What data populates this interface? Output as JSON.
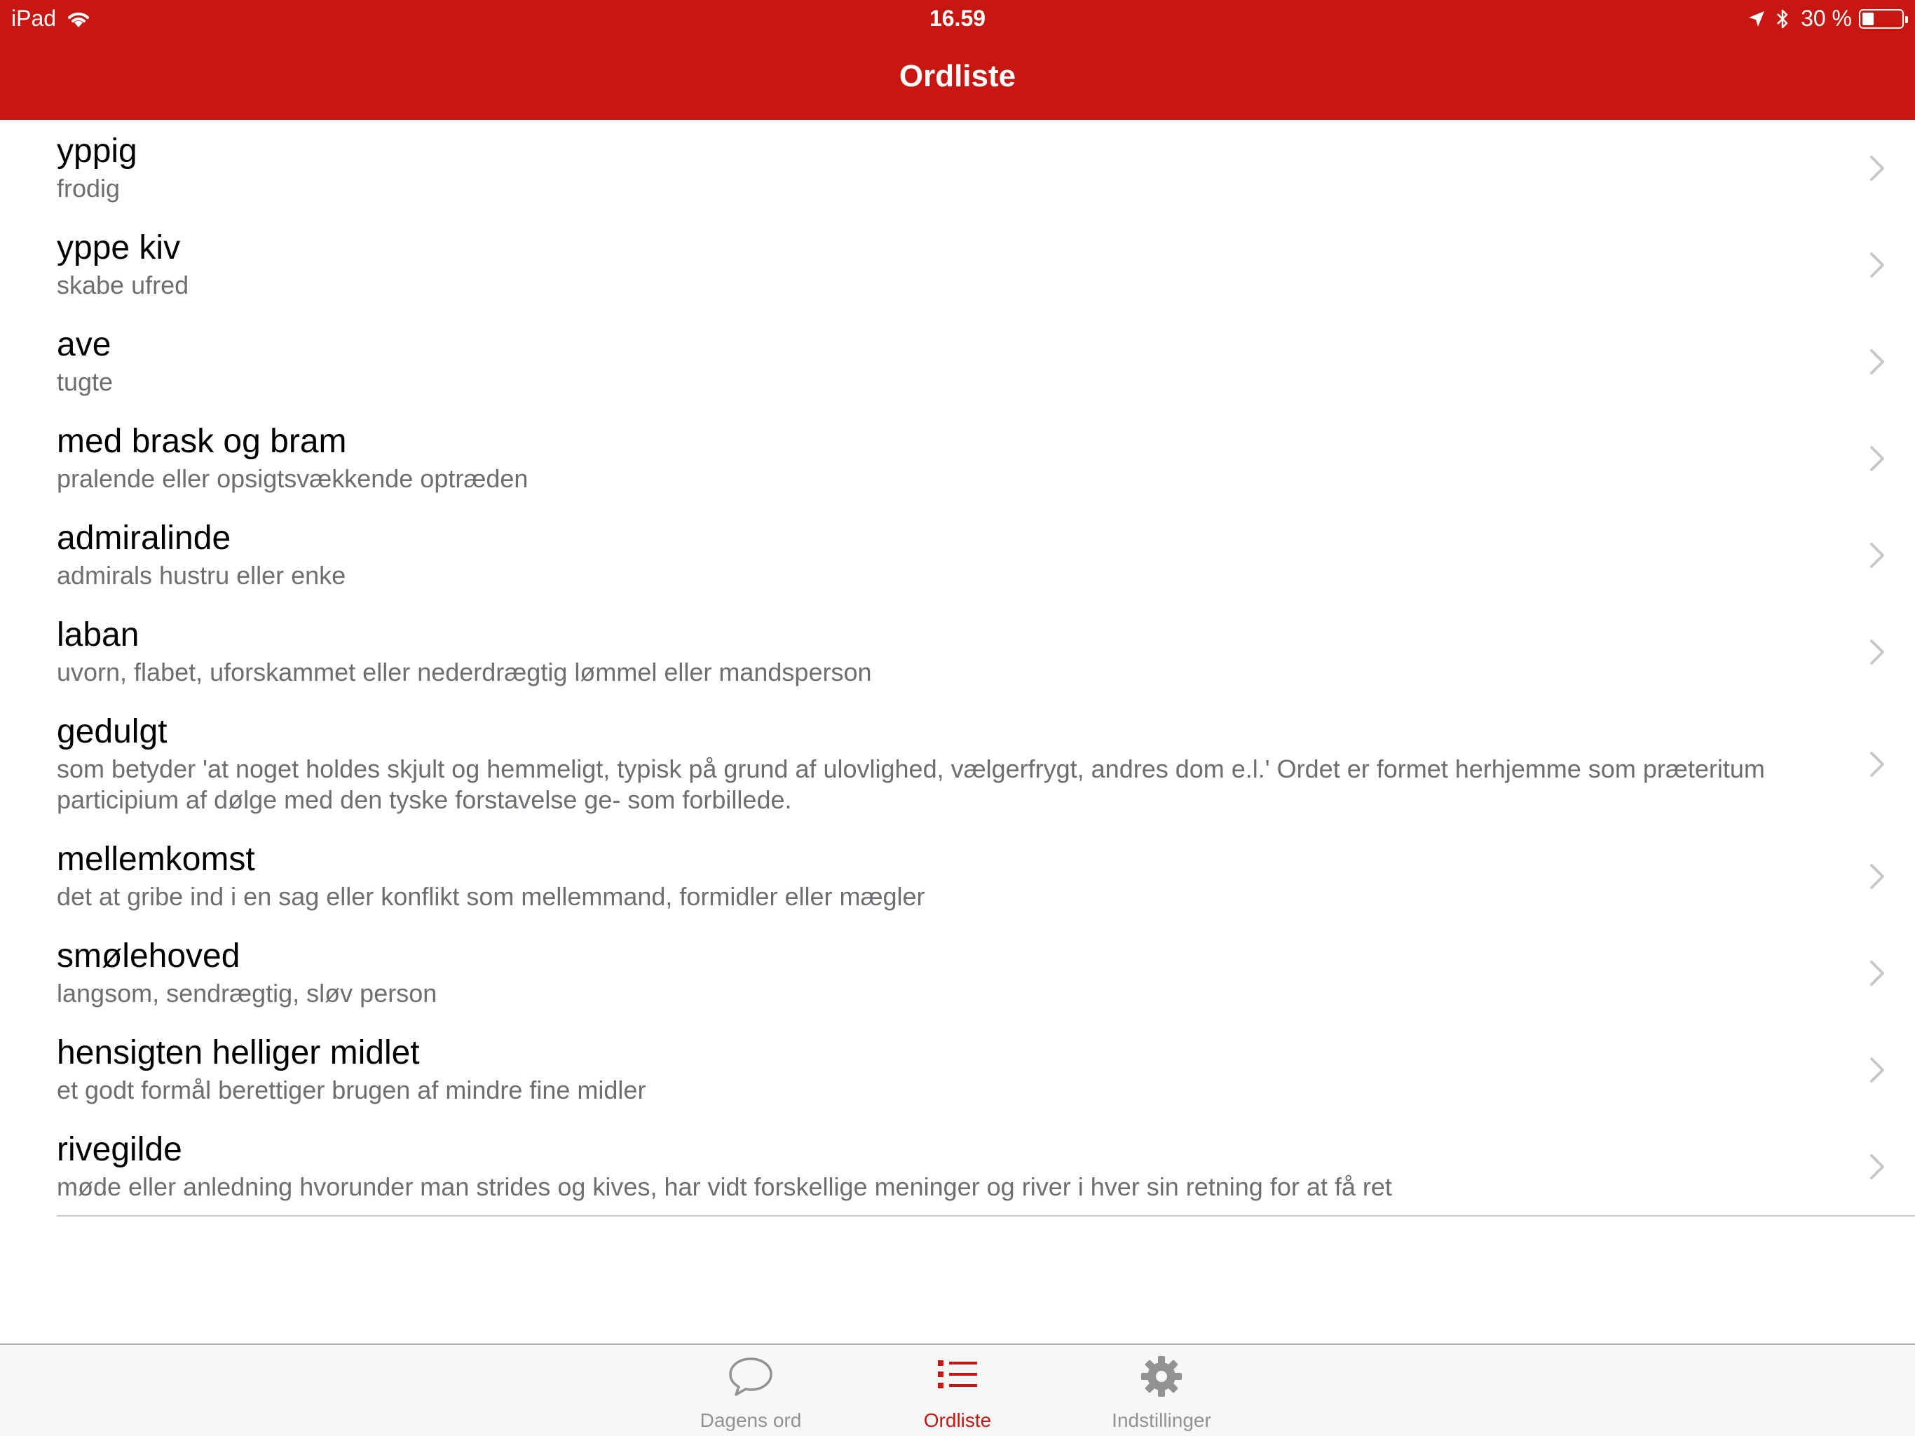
{
  "status_bar": {
    "device": "iPad",
    "time": "16.59",
    "battery_percent_text": "30 %",
    "battery_level": 0.3
  },
  "nav": {
    "title": "Ordliste"
  },
  "colors": {
    "accent": "#c81611",
    "separator": "#c8c7cc",
    "subtitle": "#6d6d72",
    "tab_inactive": "#929292"
  },
  "words": [
    {
      "word": "yppig",
      "meaning": "frodig"
    },
    {
      "word": "yppe kiv",
      "meaning": "skabe ufred"
    },
    {
      "word": "ave",
      "meaning": "tugte"
    },
    {
      "word": "med brask og bram",
      "meaning": "pralende eller opsigtsvækkende optræden"
    },
    {
      "word": "admiralinde",
      "meaning": "admirals hustru eller enke"
    },
    {
      "word": "laban",
      "meaning": "uvorn, flabet, uforskammet eller nederdrægtig lømmel eller mandsperson"
    },
    {
      "word": "gedulgt",
      "meaning": "som betyder 'at noget holdes skjult og hemmeligt, typisk på grund af ulovlighed, vælgerfrygt, andres dom e.l.' Ordet er formet herhjemme som præteritum participium af dølge med den tyske forstavelse ge- som forbillede."
    },
    {
      "word": "mellemkomst",
      "meaning": "det at gribe ind i en sag eller konflikt som mellemmand, formidler eller mægler"
    },
    {
      "word": "smølehoved",
      "meaning": "langsom, sendrægtig, sløv person"
    },
    {
      "word": "hensigten helliger midlet",
      "meaning": "et godt formål berettiger brugen af mindre fine midler"
    },
    {
      "word": "rivegilde",
      "meaning": "møde eller anledning hvorunder man strides og kives, har vidt forskellige meninger og river i hver sin retning for at få ret"
    }
  ],
  "tab_bar": {
    "tabs": [
      {
        "label": "Dagens ord",
        "icon": "speech-bubble-icon",
        "active": false
      },
      {
        "label": "Ordliste",
        "icon": "list-icon",
        "active": true
      },
      {
        "label": "Indstillinger",
        "icon": "gear-icon",
        "active": false
      }
    ]
  }
}
